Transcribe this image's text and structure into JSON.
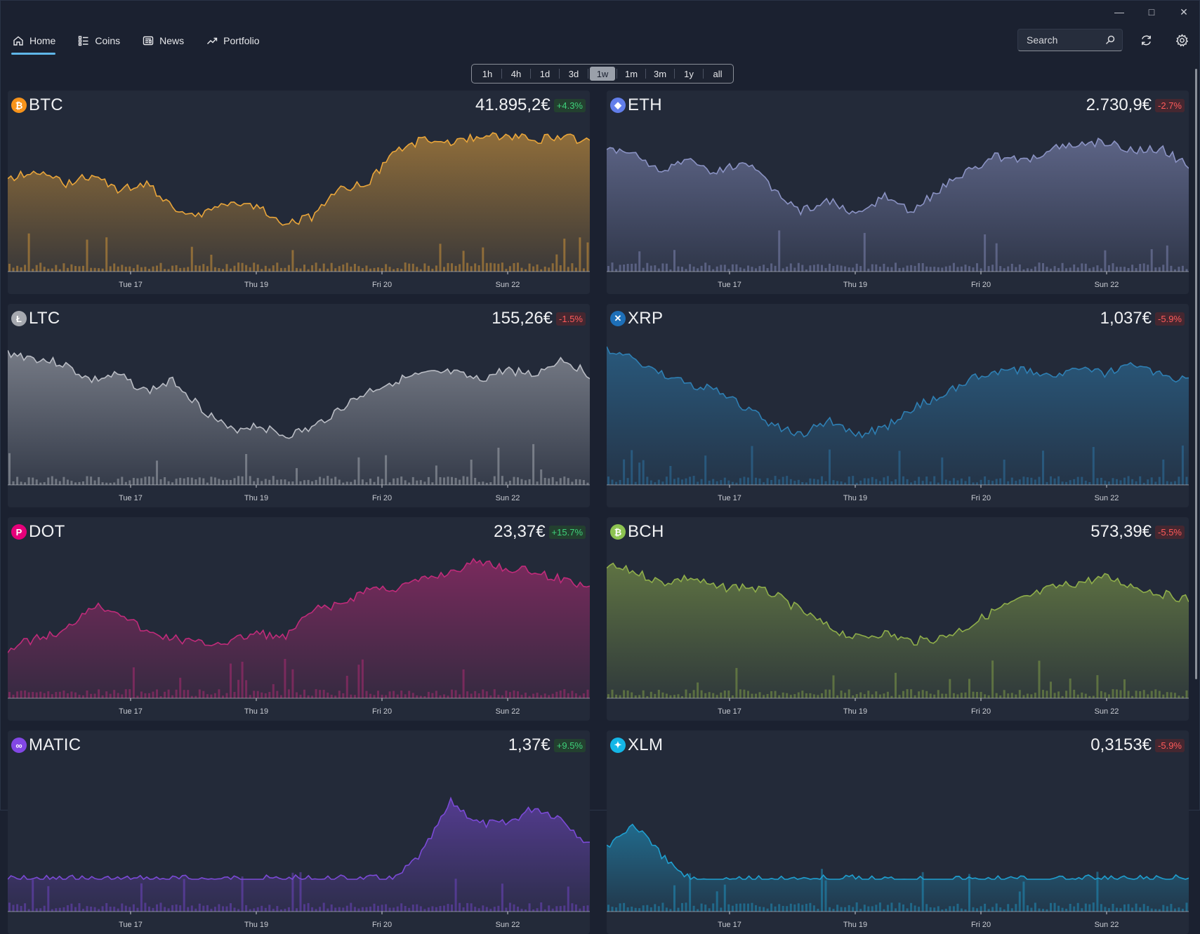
{
  "nav": {
    "items": [
      {
        "label": "Home",
        "icon": "home-icon",
        "active": true
      },
      {
        "label": "Coins",
        "icon": "list-icon",
        "active": false
      },
      {
        "label": "News",
        "icon": "news-icon",
        "active": false
      },
      {
        "label": "Portfolio",
        "icon": "trend-icon",
        "active": false
      }
    ]
  },
  "search": {
    "placeholder": "Search"
  },
  "range": {
    "options": [
      "1h",
      "4h",
      "1d",
      "3d",
      "1w",
      "1m",
      "3m",
      "1y",
      "all"
    ],
    "selected": "1w"
  },
  "x_ticks": [
    "Tue 17",
    "Thu 19",
    "Fri 20",
    "Sun 22"
  ],
  "colors": {
    "up": "#3ed07a",
    "down": "#ff5a5a"
  },
  "cards": [
    {
      "symbol": "BTC",
      "price": "41.895,2€",
      "change": "+4.3%",
      "dir": "up",
      "color": "#e9a53a",
      "icon_char": "₿",
      "icon_bg": "#f7931a",
      "seed": 1,
      "prof": "btc"
    },
    {
      "symbol": "ETH",
      "price": "2.730,9€",
      "change": "-2.7%",
      "dir": "down",
      "color": "#8b93c4",
      "icon_char": "◆",
      "icon_bg": "#627eea",
      "seed": 2,
      "prof": "eth"
    },
    {
      "symbol": "LTC",
      "price": "155,26€",
      "change": "-1.5%",
      "dir": "down",
      "color": "#b9bcc4",
      "icon_char": "Ł",
      "icon_bg": "#a6a9b0",
      "seed": 3,
      "prof": "ltc"
    },
    {
      "symbol": "XRP",
      "price": "1,037€",
      "change": "-5.9%",
      "dir": "down",
      "color": "#2e7fb3",
      "icon_char": "✕",
      "icon_bg": "#1d6fb8",
      "seed": 4,
      "prof": "xrp"
    },
    {
      "symbol": "DOT",
      "price": "23,37€",
      "change": "+15.7%",
      "dir": "up",
      "color": "#c02b7a",
      "icon_char": "P",
      "icon_bg": "#e6007a",
      "seed": 5,
      "prof": "dot"
    },
    {
      "symbol": "BCH",
      "price": "573,39€",
      "change": "-5.5%",
      "dir": "down",
      "color": "#8fae4a",
      "icon_char": "₿",
      "icon_bg": "#8dc351",
      "seed": 6,
      "prof": "bch"
    },
    {
      "symbol": "MATIC",
      "price": "1,37€",
      "change": "+9.5%",
      "dir": "up",
      "color": "#7b4ad6",
      "icon_char": "∞",
      "icon_bg": "#8247e5",
      "seed": 7,
      "prof": "matic"
    },
    {
      "symbol": "XLM",
      "price": "0,3153€",
      "change": "-5.9%",
      "dir": "down",
      "color": "#1f9fd0",
      "icon_char": "✦",
      "icon_bg": "#14b6e7",
      "seed": 8,
      "prof": "xlm"
    }
  ]
}
